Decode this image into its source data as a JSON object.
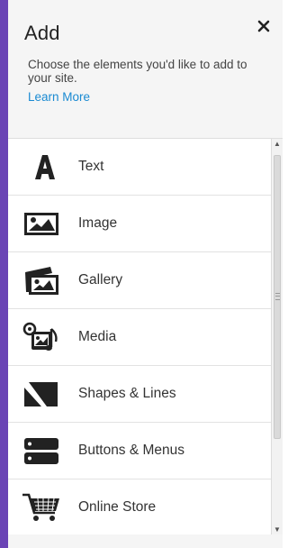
{
  "panel": {
    "title": "Add",
    "description": "Choose the elements you'd like to add to your site.",
    "learn_more": "Learn More"
  },
  "items": [
    {
      "label": "Text",
      "icon": "text-a-icon"
    },
    {
      "label": "Image",
      "icon": "image-icon"
    },
    {
      "label": "Gallery",
      "icon": "gallery-icon"
    },
    {
      "label": "Media",
      "icon": "media-icon"
    },
    {
      "label": "Shapes & Lines",
      "icon": "shapes-icon"
    },
    {
      "label": "Buttons & Menus",
      "icon": "buttons-menus-icon"
    },
    {
      "label": "Online Store",
      "icon": "shopping-cart-icon"
    }
  ],
  "colors": {
    "accent_bar": "#6a44b5",
    "link": "#1a8ad2",
    "icon": "#222222"
  }
}
